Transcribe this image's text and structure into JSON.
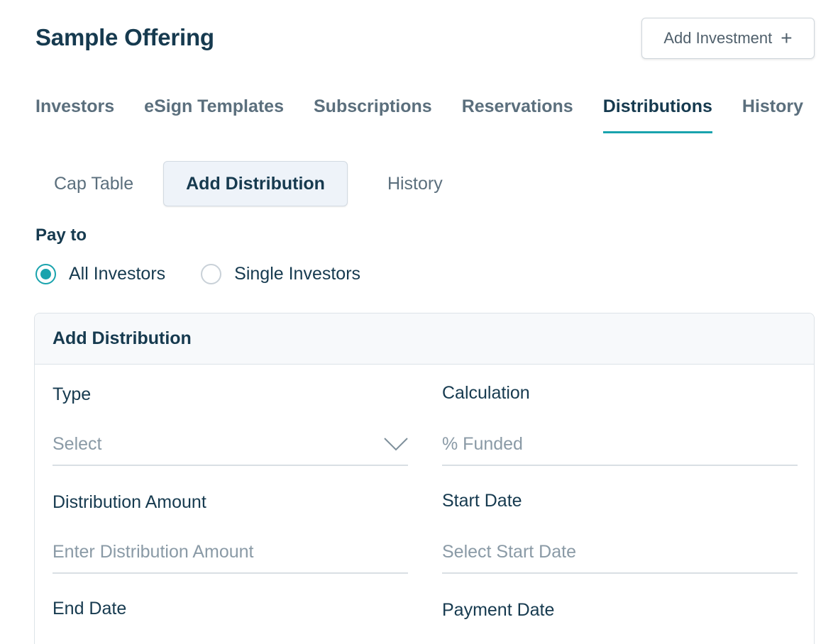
{
  "header": {
    "title": "Sample Offering",
    "add_investment_label": "Add Investment",
    "add_investment_icon": "plus-icon"
  },
  "main_tabs": [
    {
      "label": "Investors",
      "active": false
    },
    {
      "label": "eSign Templates",
      "active": false
    },
    {
      "label": "Subscriptions",
      "active": false
    },
    {
      "label": "Reservations",
      "active": false
    },
    {
      "label": "Distributions",
      "active": true
    },
    {
      "label": "History",
      "active": false
    }
  ],
  "sub_tabs": [
    {
      "label": "Cap Table",
      "active": false
    },
    {
      "label": "Add Distribution",
      "active": true
    },
    {
      "label": "History",
      "active": false
    }
  ],
  "pay_to": {
    "label": "Pay to",
    "options": [
      {
        "label": "All Investors",
        "checked": true
      },
      {
        "label": "Single Investors",
        "checked": false
      }
    ]
  },
  "card": {
    "title": "Add Distribution",
    "fields": {
      "type": {
        "label": "Type",
        "placeholder": "Select",
        "icon": "chevron-down-icon"
      },
      "calculation": {
        "label": "Calculation",
        "value": "% Funded"
      },
      "distribution_amount": {
        "label": "Distribution Amount",
        "placeholder": "Enter Distribution Amount"
      },
      "start_date": {
        "label": "Start Date",
        "placeholder": "Select Start Date"
      },
      "end_date": {
        "label": "End Date"
      },
      "payment_date": {
        "label": "Payment Date"
      }
    }
  },
  "colors": {
    "accent": "#19a3ad",
    "text_primary": "#163a4f",
    "text_muted": "#5b6f7d",
    "placeholder": "#8a9aa6"
  }
}
